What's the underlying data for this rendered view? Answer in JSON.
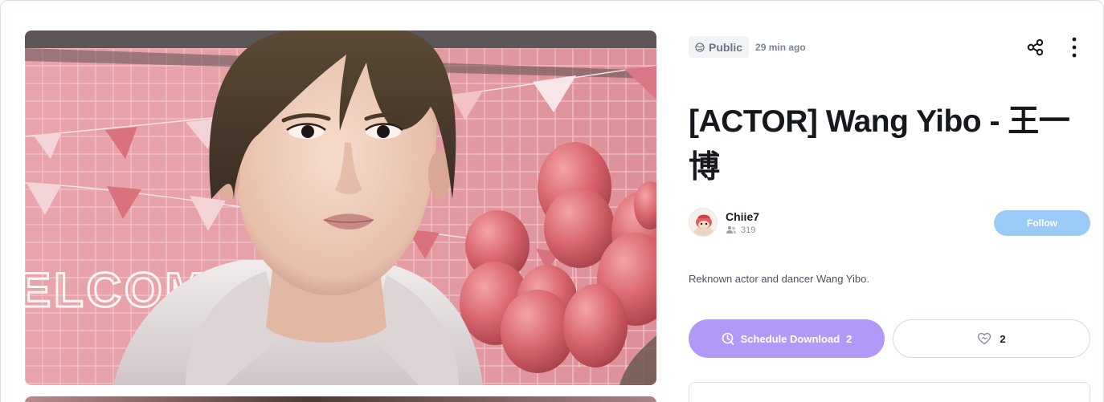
{
  "post": {
    "visibility": "Public",
    "time_ago": "29 min ago",
    "title": "[ACTOR] Wang Yibo - 王一博",
    "description": "Reknown actor and dancer Wang Yibo."
  },
  "author": {
    "name": "Chiie7",
    "followers": "319"
  },
  "actions": {
    "follow_label": "Follow",
    "download_label": "Schedule Download",
    "download_count": "2",
    "like_count": "2"
  },
  "hero_image": {
    "sign_text": "ELCOM"
  },
  "icons": {
    "visibility": "globe-icon",
    "share": "share-icon",
    "more": "more-vertical-icon",
    "followers": "users-icon",
    "download": "clock-download-icon",
    "like": "heart-icon"
  },
  "colors": {
    "follow_button": "#9ccaf7",
    "download_button": "#b399f7",
    "title_text": "#15181d",
    "chip_background": "#f1f3f6"
  }
}
